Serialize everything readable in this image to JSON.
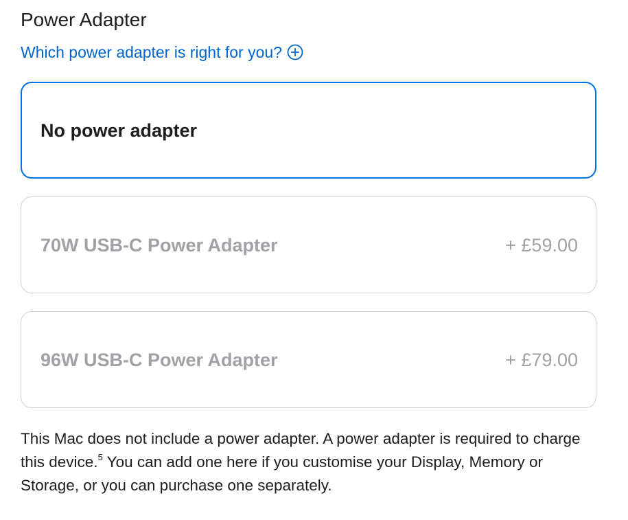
{
  "section": {
    "title": "Power Adapter",
    "help_link": "Which power adapter is right for you?",
    "help_icon": "plus-circle-icon"
  },
  "options": [
    {
      "name": "No power adapter",
      "price": "",
      "state": "selected"
    },
    {
      "name": "70W USB-C Power Adapter",
      "price": "+ £59.00",
      "state": "disabled"
    },
    {
      "name": "96W USB-C Power Adapter",
      "price": "+ £79.00",
      "state": "disabled"
    }
  ],
  "footnote": {
    "text_before": "This Mac does not include a power adapter. A power adapter is required to charge this device.",
    "superscript": "5",
    "text_after": " You can add one here if you customise your Display, Memory or Storage, or you can purchase one separately."
  },
  "colors": {
    "link": "#0066cc",
    "selected_border": "#0071e3",
    "disabled_text": "#a1a1a6",
    "border": "#d2d2d7"
  }
}
